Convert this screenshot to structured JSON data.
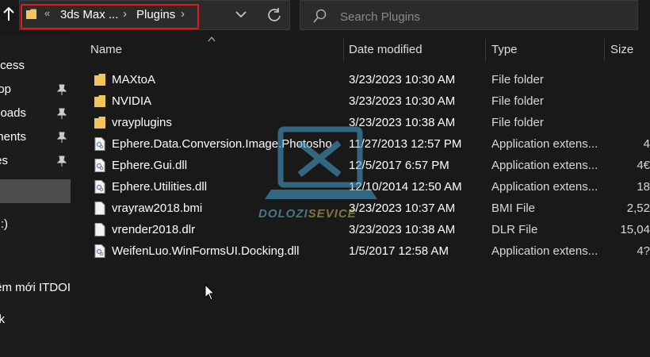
{
  "address_bar": {
    "overflow_glyph": "«",
    "crumbs": [
      "3ds Max ...",
      "Plugins"
    ],
    "separator": "›"
  },
  "search": {
    "placeholder": "Search Plugins",
    "value": ""
  },
  "sidebar": {
    "items": [
      {
        "label": "ccess",
        "pinned": false
      },
      {
        "label": "op",
        "pinned": true
      },
      {
        "label": "oads",
        "pinned": true
      },
      {
        "label": "ments",
        "pinned": true
      },
      {
        "label": "es",
        "pinned": true
      },
      {
        "label": "",
        "pinned": false,
        "selected": true
      },
      {
        "label": ":)",
        "pinned": false
      },
      {
        "label": "êm mới ITDOI",
        "pinned": false
      },
      {
        "label": "k",
        "pinned": false
      }
    ]
  },
  "columns": {
    "name": "Name",
    "date": "Date modified",
    "type": "Type",
    "size": "Size"
  },
  "files": [
    {
      "name": "MAXtoA",
      "date": "3/23/2023 10:30 AM",
      "type": "File folder",
      "size": "",
      "icon": "folder-icon"
    },
    {
      "name": "NVIDIA",
      "date": "3/23/2023 10:30 AM",
      "type": "File folder",
      "size": "",
      "icon": "folder-icon"
    },
    {
      "name": "vrayplugins",
      "date": "3/23/2023 10:38 AM",
      "type": "File folder",
      "size": "",
      "icon": "folder-icon"
    },
    {
      "name": "Ephere.Data.Conversion.Image.Photosho...",
      "date": "11/27/2013 12:57 PM",
      "type": "Application extens...",
      "size": "4",
      "icon": "dll-icon"
    },
    {
      "name": "Ephere.Gui.dll",
      "date": "12/5/2017 6:57 PM",
      "type": "Application extens...",
      "size": "4€",
      "icon": "dll-icon"
    },
    {
      "name": "Ephere.Utilities.dll",
      "date": "12/10/2014 12:50 AM",
      "type": "Application extens...",
      "size": "18",
      "icon": "dll-icon"
    },
    {
      "name": "vrayraw2018.bmi",
      "date": "3/23/2023 10:37 AM",
      "type": "BMI File",
      "size": "2,52",
      "icon": "file-icon"
    },
    {
      "name": "vrender2018.dlr",
      "date": "3/23/2023 10:38 AM",
      "type": "DLR File",
      "size": "15,04",
      "icon": "file-icon"
    },
    {
      "name": "WeifenLuo.WinFormsUI.Docking.dll",
      "date": "1/5/2017 12:58 AM",
      "type": "Application extens...",
      "size": "4?",
      "icon": "dll-icon"
    }
  ],
  "watermark": {
    "part1": "DOLOZI",
    "part2": "SEVICE"
  },
  "colors": {
    "highlight": "#e11b1b",
    "folder": "#f2c55c",
    "background": "#191919"
  }
}
